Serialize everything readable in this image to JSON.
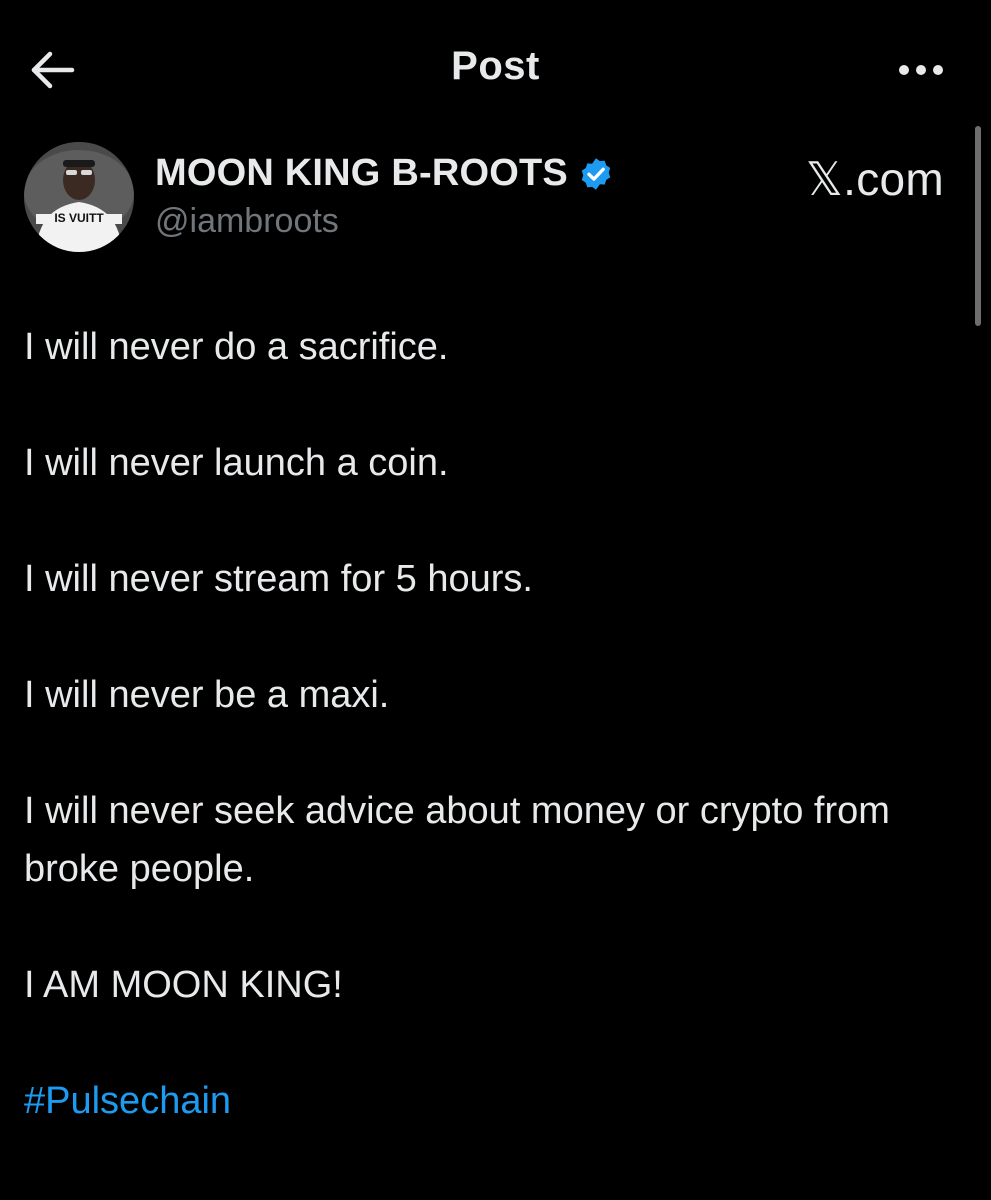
{
  "header": {
    "title": "Post",
    "back_icon": "arrow-left-icon",
    "more_icon": "more-horizontal-icon"
  },
  "author": {
    "display_name": "MOON KING B-ROOTS",
    "handle": "@iambroots",
    "verified_icon": "verified-badge-icon",
    "verified_color": "#1d9bf0",
    "avatar_text": "IS VUITT"
  },
  "watermark": "𝕏.com",
  "post": {
    "lines": [
      "I will never do a sacrifice.",
      "I will never launch a coin.",
      "I will never stream for 5 hours.",
      "I will never be a maxi.",
      "I will never seek advice about money or crypto from broke people.",
      "I AM MOON KING!"
    ],
    "hashtag": "#Pulsechain"
  },
  "colors": {
    "background": "#000000",
    "text": "#e7e9ea",
    "secondary": "#71767b",
    "link": "#1d9bf0"
  }
}
